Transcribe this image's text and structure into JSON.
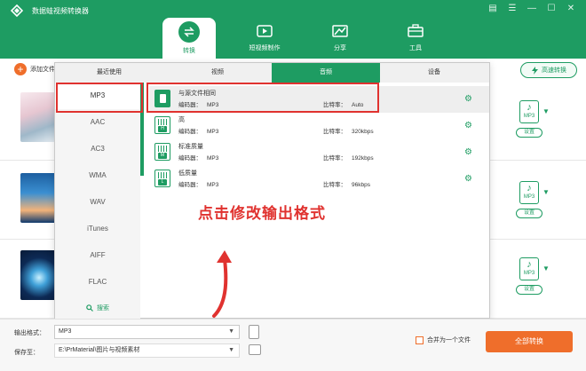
{
  "window": {
    "title": "数据蛙视频转换器",
    "controls": [
      "▤",
      "☰",
      "—",
      "☐",
      "✕"
    ]
  },
  "nav": {
    "items": [
      {
        "label": "转换",
        "active": true
      },
      {
        "label": "短视频制作",
        "active": false
      },
      {
        "label": "分享",
        "active": false
      },
      {
        "label": "工具",
        "active": false
      }
    ]
  },
  "toolbar": {
    "add_file_label": "添加文件",
    "fast_convert_label": "高速转换"
  },
  "rows": [
    {
      "settings_label": "设置",
      "format": "MP3"
    },
    {
      "settings_label": "设置",
      "format": "MP3"
    },
    {
      "settings_label": "设置",
      "format": "MP3"
    }
  ],
  "popup": {
    "tabs": [
      {
        "label": "最近使用",
        "active": false
      },
      {
        "label": "视频",
        "active": false
      },
      {
        "label": "音频",
        "active": true
      },
      {
        "label": "设备",
        "active": false
      }
    ],
    "formats": [
      "MP3",
      "AAC",
      "AC3",
      "WMA",
      "WAV",
      "iTunes",
      "AIFF",
      "FLAC"
    ],
    "selected_format": "MP3",
    "search_label": "搜索",
    "presets": [
      {
        "name": "与源文件相同",
        "encoder_label": "编码器：",
        "encoder": "MP3",
        "bitrate_label": "比特率：",
        "bitrate": "Auto",
        "badge": ""
      },
      {
        "name": "高",
        "encoder_label": "编码器：",
        "encoder": "MP3",
        "bitrate_label": "比特率：",
        "bitrate": "320kbps",
        "badge": "H"
      },
      {
        "name": "标准质量",
        "encoder_label": "编码器：",
        "encoder": "MP3",
        "bitrate_label": "比特率：",
        "bitrate": "192kbps",
        "badge": "M"
      },
      {
        "name": "低质量",
        "encoder_label": "编码器：",
        "encoder": "MP3",
        "bitrate_label": "比特率：",
        "bitrate": "96kbps",
        "badge": "L"
      }
    ]
  },
  "annotation": {
    "text": "点击修改输出格式",
    "color": "#e0322f"
  },
  "bottom": {
    "output_format_label": "输出格式：",
    "output_format_value": "MP3",
    "save_to_label": "保存至：",
    "save_path": "E:\\PrMaterial\\图片与视频素材",
    "merge_label": "合并为一个文件",
    "convert_all_label": "全部转换"
  },
  "colors": {
    "brand_green": "#1e9c62",
    "accent_orange": "#ef6e2b"
  }
}
